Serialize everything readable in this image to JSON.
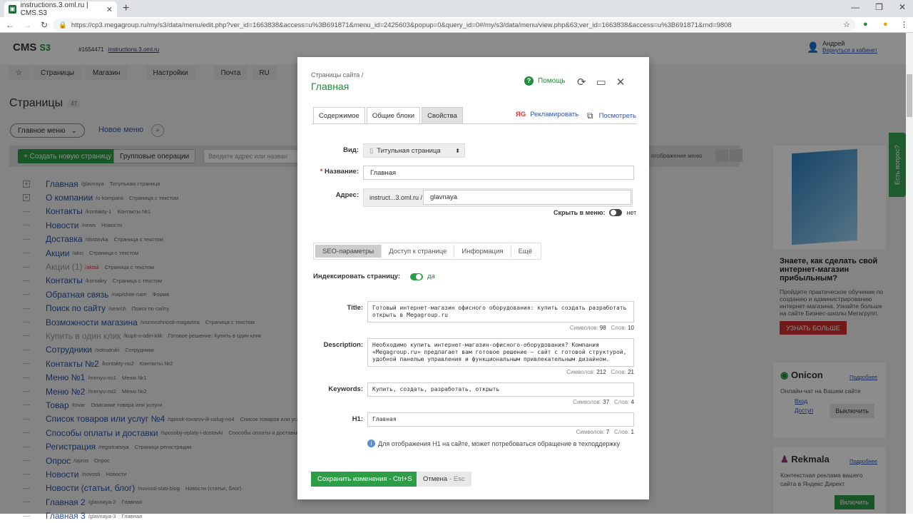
{
  "browser": {
    "tab_title": "instructions.3.oml.ru | CMS.S3",
    "url": "https://cp3.megagroup.ru/my/s3/data/menu/edit.php?ver_id=1663838&access=u%3B691871&menu_id=2425603&popup=0&query_id=0#/my/s3/data/menu/view.php&63;ver_id=1663838&access=u%3B691871&rnd=9808"
  },
  "header": {
    "logo": "CMS",
    "logo_suffix": "S3",
    "site_num": "#1654471",
    "site_link": "instructions.3.oml.ru",
    "user": "Андрей",
    "return_link": "Вернуться в кабинет"
  },
  "toolbar": [
    "Страницы",
    "Магазин",
    "Настройки",
    "Почта",
    "RU"
  ],
  "pages": {
    "title": "Страницы",
    "count": "47",
    "menu_main": "Главное меню",
    "new_menu": "Новое меню",
    "create_btn": "+ Создать новую страницу",
    "group_ops": "Групповые операции",
    "search_placeholder": "Введите адрес или назван",
    "display_mode": "отображение меню"
  },
  "tree": [
    {
      "name": "Главная",
      "slug": "/glavnaya",
      "type": "Титульная страница",
      "exp": true
    },
    {
      "name": "О компании",
      "slug": "/o-kompanii",
      "type": "Страница с текстом",
      "exp": true
    },
    {
      "name": "Контакты",
      "slug": "/kontakty-1",
      "type": "Контакты №1"
    },
    {
      "name": "Новости",
      "slug": "/news",
      "type": "Новости"
    },
    {
      "name": "Доставка",
      "slug": "/dostavka",
      "type": "Страница с текстом"
    },
    {
      "name": "Акции",
      "slug": "/akci",
      "type": "Страница с текстом"
    },
    {
      "name": "Акции (1)",
      "slug": "/aktsii",
      "type": "Страница с текстом",
      "gray": true
    },
    {
      "name": "Контакты",
      "slug": "/kontakty",
      "type": "Страница с текстом"
    },
    {
      "name": "Обратная связь",
      "slug": "/napishite-nam",
      "type": "Форма"
    },
    {
      "name": "Поиск по сайту",
      "slug": "/search",
      "type": "Поиск по сайту"
    },
    {
      "name": "Возможности магазина",
      "slug": "/vozmozhnosti-magazina",
      "type": "Страница с текстом"
    },
    {
      "name": "Купить в один клик",
      "slug": "/kupit-v-odin-klik",
      "type": "Готовое решение: Купить в один клик",
      "gray": true
    },
    {
      "name": "Сотрудники",
      "slug": "/sotrudniki",
      "type": "Сотрудники"
    },
    {
      "name": "Контакты №2",
      "slug": "/kontakty-no2",
      "type": "Контакты №2"
    },
    {
      "name": "Меню №1",
      "slug": "/menyu-no1",
      "type": "Меню №1"
    },
    {
      "name": "Меню №2",
      "slug": "/menyu-no2",
      "type": "Меню №2"
    },
    {
      "name": "Товар",
      "slug": "/tovar",
      "type": "Описание товара или услуги"
    },
    {
      "name": "Список товаров или услуг №4",
      "slug": "/spisok-tovarov-ili-uslug-no4",
      "type": "Список товаров или услуг №"
    },
    {
      "name": "Способы оплаты и доставки",
      "slug": "/sposoby-oplaty-i-dostavki",
      "type": "Способы оплаты и доставки"
    },
    {
      "name": "Регистрация",
      "slug": "/registratsiya",
      "type": "Страница регистрации"
    },
    {
      "name": "Опрос",
      "slug": "/opros",
      "type": "Опрос"
    },
    {
      "name": "Новости",
      "slug": "/novosti",
      "type": "Новости"
    },
    {
      "name": "Новости (статьи, блог)",
      "slug": "/novosti-stati-blog",
      "type": "Новости (статьи, блог)"
    },
    {
      "name": "Главная 2",
      "slug": "/glavnaya-2",
      "type": "Главная"
    },
    {
      "name": "Главная 3",
      "slug": "/glavnaya-3",
      "type": "Главная"
    }
  ],
  "sidebar": {
    "ad_title": "Знаете, как сделать свой интернет-магазин прибыльным?",
    "ad_desc": "Пройдите практическое обучение по созданию и администрированию интернет-магазина. Узнайте больше на сайте Бизнес-школы Мегагрупп.",
    "ad_btn": "УЗНАТЬ БОЛЬШЕ",
    "onicon": "Onicon",
    "onicon_more": "Подробнее",
    "onicon_desc": "Онлайн-чат на Вашем сайте",
    "login": "Вход",
    "access": "Доступ",
    "off": "Выключить",
    "rekmala": "Rekmala",
    "rekmala_more": "Подробнее",
    "rekmala_desc": "Контекстная реклама вашего сайта в Яндекс Директ",
    "on": "Включить",
    "feedback": "Есть вопрос?"
  },
  "modal": {
    "crumb": "Страницы сайта /",
    "title": "Главная",
    "help": "Помощь",
    "tabs": [
      "Содержимое",
      "Общие блоки",
      "Свойства"
    ],
    "promote": "Рекламировать",
    "preview": "Посмотреть",
    "type_label": "Вид:",
    "type_value": "Титульная страница",
    "name_label": "Название:",
    "name_value": "Главная",
    "addr_label": "Адрес:",
    "addr_prefix": "instruct...3.oml.ru /",
    "addr_value": "glavnaya",
    "hide_label": "Скрыть в меню:",
    "hide_value": "нет",
    "subtabs": [
      "SEO-параметры",
      "Доступ к странице",
      "Информация",
      "Ещё"
    ],
    "index_label": "Индексировать страницу:",
    "index_value": "да",
    "title_label": "Title:",
    "title_value": "Готовый интернет-магазин офисного оборудования:  купить создать разработать открыть в Megagroup.ru",
    "title_chars": "98",
    "title_words": "10",
    "desc_label": "Description:",
    "desc_value": "Необходимо купить интернет-магазин-офисного-оборудования? Компания «Megagroup.ru» предлагает  вам готовое решение – сайт с готовой структурой, удобной панелью управления и функциональным привлекательным дизайном.",
    "desc_chars": "212",
    "desc_words": "21",
    "kw_label": "Keywords:",
    "kw_value": "Купить, создать, разработать, открыть",
    "kw_chars": "37",
    "kw_words": "4",
    "h1_label": "H1:",
    "h1_value": "Главная",
    "h1_chars": "7",
    "h1_words": "1",
    "chars_label": "Символов:",
    "words_label": "Слов:",
    "info": "Для отображения H1 на сайте, может потребоваться обращение в техподдержку",
    "save": "Сохранить изменения - Ctrl+S",
    "cancel": "Отмена",
    "cancel_key": "- Esc"
  }
}
